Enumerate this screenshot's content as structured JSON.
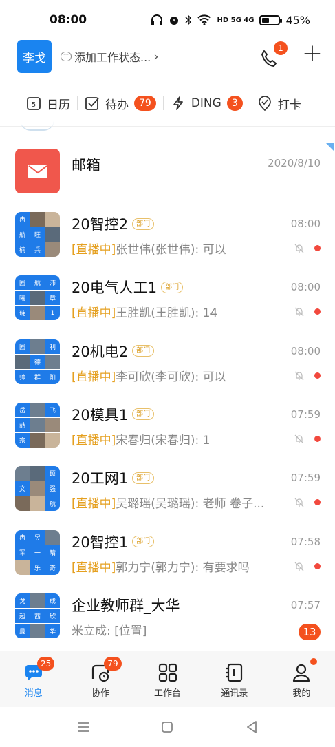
{
  "status_bar": {
    "time": "08:00",
    "battery": "45%",
    "battery_level": 0.45,
    "network": "HD 5G 4G"
  },
  "header": {
    "avatar_name": "李戈",
    "status_placeholder": "添加工作状态...",
    "call_badge": "1"
  },
  "quickbar": [
    {
      "label": "日历",
      "icon": "calendar-icon",
      "badge": ""
    },
    {
      "label": "待办",
      "icon": "todo-check-icon",
      "badge": "79"
    },
    {
      "label": "DING",
      "icon": "ding-lightning-icon",
      "badge": "3"
    },
    {
      "label": "打卡",
      "icon": "checkin-location-icon",
      "badge": ""
    }
  ],
  "mailbox": {
    "title": "邮箱",
    "time": "2020/8/10"
  },
  "conversations": [
    {
      "title": "20智控2",
      "tag": "部门",
      "live": "[直播中]",
      "preview": "张世伟(张世伟): 可以",
      "time": "08:00",
      "cells": [
        "冉",
        "",
        "",
        "航",
        "旺",
        "",
        "楠",
        "兵",
        ""
      ]
    },
    {
      "title": "20电气人工1",
      "tag": "部门",
      "live": "[直播中]",
      "preview": "王胜凯(王胜凯): 14",
      "time": "08:00",
      "cells": [
        "园",
        "航",
        "沛",
        "曦",
        "",
        "章",
        "琏",
        "",
        "1"
      ]
    },
    {
      "title": "20机电2",
      "tag": "部门",
      "live": "[直播中]",
      "preview": "李可欣(李可欣): 可以",
      "time": "08:00",
      "cells": [
        "园",
        "",
        "利",
        "",
        "德",
        "",
        "帅",
        "群",
        "阳"
      ]
    },
    {
      "title": "20模具1",
      "tag": "部门",
      "live": "[直播中]",
      "preview": "宋春归(宋春归): 1",
      "time": "07:59",
      "cells": [
        "岳",
        "",
        "飞",
        "喆",
        "",
        "",
        "宗",
        "",
        ""
      ]
    },
    {
      "title": "20工网1",
      "tag": "部门",
      "live": "[直播中]",
      "preview": "吴璐瑶(吴璐瑶): 老师 卷子...",
      "time": "07:59",
      "cells": [
        "",
        "",
        "硕",
        "文",
        "",
        "强",
        "",
        "",
        "航"
      ]
    },
    {
      "title": "20智控1",
      "tag": "部门",
      "live": "[直播中]",
      "preview": "郭力宁(郭力宁): 有要求吗",
      "time": "07:58",
      "cells": [
        "冉",
        "昱",
        "",
        "军",
        "一",
        "晴",
        "",
        "乐",
        "奇"
      ]
    },
    {
      "title": "企业教师群_大华",
      "tag": "",
      "live": "",
      "preview": "米立成: [位置]",
      "time": "07:57",
      "badge": "13",
      "cells": [
        "戈",
        "",
        "成",
        "超",
        "茜",
        "欣",
        "曼",
        "",
        "华"
      ]
    }
  ],
  "tabs": [
    {
      "label": "消息",
      "icon": "message-icon",
      "badge": "25",
      "active": true
    },
    {
      "label": "协作",
      "icon": "collab-icon",
      "badge": "79"
    },
    {
      "label": "工作台",
      "icon": "workbench-icon",
      "badge": ""
    },
    {
      "label": "通讯录",
      "icon": "contacts-icon",
      "badge": ""
    },
    {
      "label": "我的",
      "icon": "profile-icon",
      "badge": "",
      "dot": true
    }
  ],
  "colors": {
    "brand": "#1a84f0",
    "badge": "#f4511e",
    "live": "#e5a020",
    "mail": "#f0574c"
  }
}
